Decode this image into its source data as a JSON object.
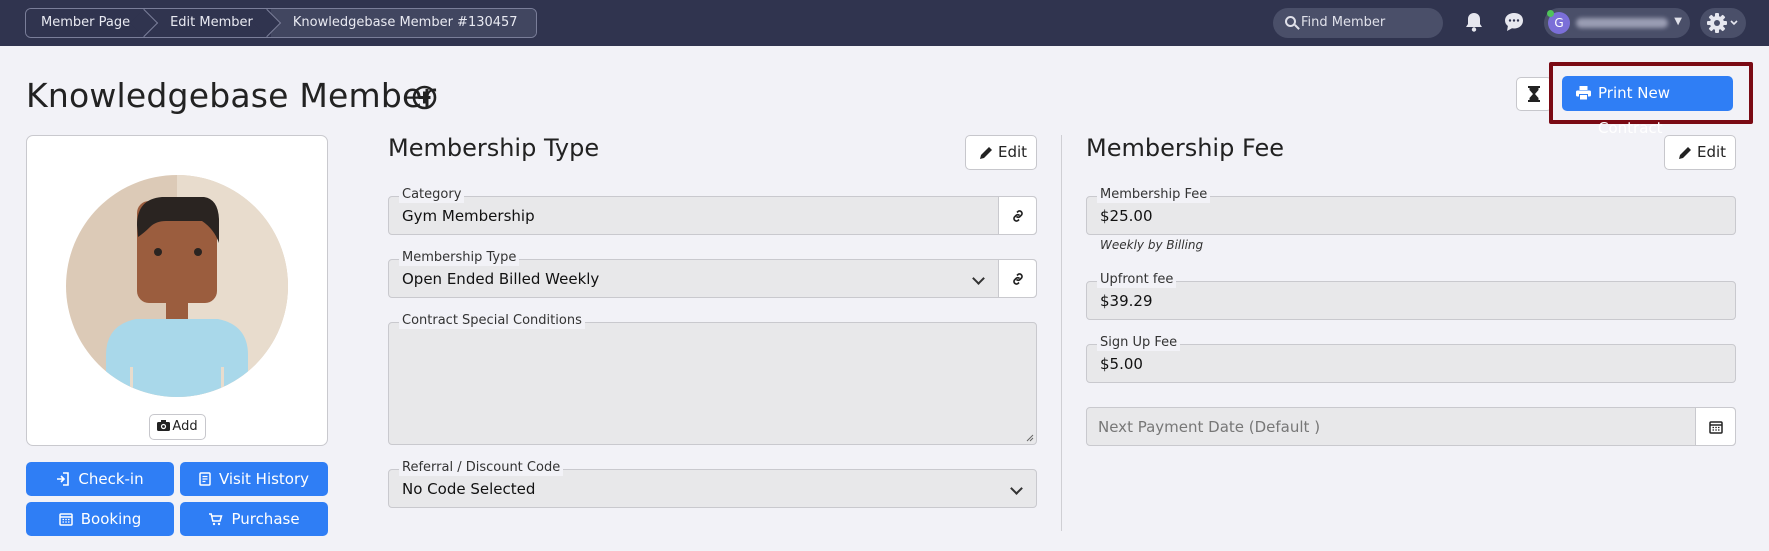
{
  "breadcrumb": [
    "Member Page",
    "Edit Member",
    "Knowledgebase Member #130457"
  ],
  "header": {
    "search_placeholder": "Find Member",
    "user_initial": "G"
  },
  "page": {
    "title": "Knowledgebase Member",
    "print_button": "Print New Contract"
  },
  "avatar_card": {
    "add_label": "Add"
  },
  "actions": {
    "checkin": "Check-in",
    "visit_history": "Visit History",
    "booking": "Booking",
    "purchase": "Purchase"
  },
  "membership_type": {
    "title": "Membership Type",
    "edit_label": "Edit",
    "category_label": "Category",
    "category_value": "Gym Membership",
    "type_label": "Membership Type",
    "type_value": "Open Ended Billed Weekly",
    "conditions_label": "Contract Special Conditions",
    "conditions_value": "",
    "referral_label": "Referral / Discount Code",
    "referral_value": "No Code Selected"
  },
  "membership_fee": {
    "title": "Membership Fee",
    "edit_label": "Edit",
    "fee_label": "Membership Fee",
    "fee_value": "$25.00",
    "fee_hint": "Weekly by Billing",
    "upfront_label": "Upfront fee",
    "upfront_value": "$39.29",
    "signup_label": "Sign Up Fee",
    "signup_value": "$5.00",
    "next_payment_placeholder": "Next Payment Date (Default )"
  },
  "colors": {
    "topbar": "#30344f",
    "primary": "#2f7ef5",
    "highlight": "#7a0a14"
  }
}
